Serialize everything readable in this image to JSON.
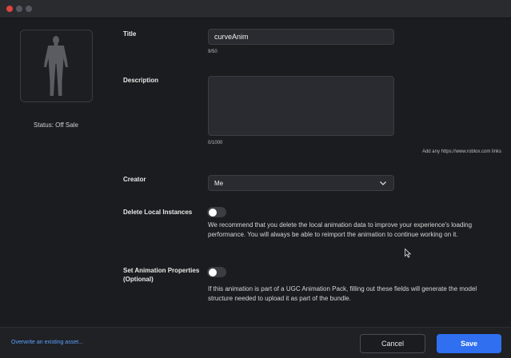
{
  "status": "Status: Off Sale",
  "form": {
    "title_label": "Title",
    "title_value": "curveAnim",
    "title_counter": "9/50",
    "description_label": "Description",
    "description_value": "",
    "description_counter": "0/1000",
    "description_hint": "Add any https://www.roblox.com links",
    "creator_label": "Creator",
    "creator_value": "Me",
    "delete_label": "Delete Local Instances",
    "delete_text": "We recommend that you delete the local animation data to improve your experience's loading performance. You will always be able to reimport the animation to continue working on it.",
    "props_label": "Set Animation Properties (Optional)",
    "props_text": "If this animation is part of a UGC Animation Pack, filling out these fields will generate the model structure needed to upload it as part of the bundle."
  },
  "toggles": {
    "delete_local_instances": false,
    "set_animation_properties": false
  },
  "footer": {
    "overwrite_link": "Overwrite an existing asset...",
    "cancel_label": "Cancel",
    "save_label": "Save"
  },
  "colors": {
    "accent": "#2f6ff0",
    "link": "#5aa2ff",
    "background": "#1b1c1f"
  },
  "icons": {
    "preview": "character-silhouette-icon",
    "dropdown": "chevron-down-icon"
  }
}
